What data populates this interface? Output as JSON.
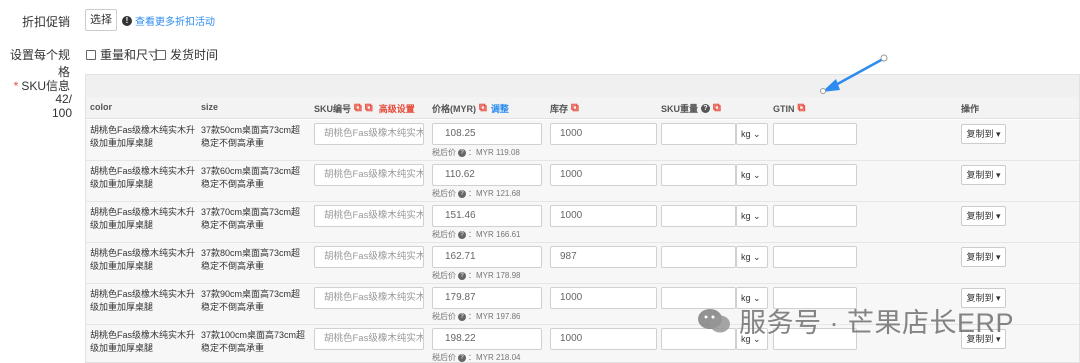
{
  "form": {
    "discount_label": "折扣促销",
    "select_label": "选择",
    "more_discount_link": "查看更多折扣活动",
    "spec_label": "设置每个规格",
    "checkbox_weight_size": "重量和尺寸",
    "checkbox_ship_time": "发货时间",
    "sku_label": "SKU信息",
    "sku_count": "42/ 100"
  },
  "table": {
    "headers": {
      "color": "color",
      "size": "size",
      "sku_code": "SKU编号",
      "advanced": "高级设置",
      "price": "价格(MYR)",
      "adjust": "调整",
      "stock": "库存",
      "weight": "SKU重量",
      "gtin": "GTIN",
      "action": "操作"
    },
    "rows": [
      {
        "color": "胡桃色Fas级橡木纯实木升级加重加厚桌腿",
        "size": "37款50cm桌面高73cm超稳定不倒高承重",
        "sku_code": "胡桃色Fas级橡木纯实木",
        "price": "108.25",
        "post_tax": "MYR 119.08",
        "stock": "1000",
        "unit": "kg",
        "copy": "复制到"
      },
      {
        "color": "胡桃色Fas级橡木纯实木升级加重加厚桌腿",
        "size": "37款60cm桌面高73cm超稳定不倒高承重",
        "sku_code": "胡桃色Fas级橡木纯实木",
        "price": "110.62",
        "post_tax": "MYR 121.68",
        "stock": "1000",
        "unit": "kg",
        "copy": "复制到"
      },
      {
        "color": "胡桃色Fas级橡木纯实木升级加重加厚桌腿",
        "size": "37款70cm桌面高73cm超稳定不倒高承重",
        "sku_code": "胡桃色Fas级橡木纯实木",
        "price": "151.46",
        "post_tax": "MYR 166.61",
        "stock": "1000",
        "unit": "kg",
        "copy": "复制到"
      },
      {
        "color": "胡桃色Fas级橡木纯实木升级加重加厚桌腿",
        "size": "37款80cm桌面高73cm超稳定不倒高承重",
        "sku_code": "胡桃色Fas级橡木纯实木",
        "price": "162.71",
        "post_tax": "MYR 178.98",
        "stock": "987",
        "unit": "kg",
        "copy": "复制到"
      },
      {
        "color": "胡桃色Fas级橡木纯实木升级加重加厚桌腿",
        "size": "37款90cm桌面高73cm超稳定不倒高承重",
        "sku_code": "胡桃色Fas级橡木纯实木",
        "price": "179.87",
        "post_tax": "MYR 197.86",
        "stock": "1000",
        "unit": "kg",
        "copy": "复制到"
      },
      {
        "color": "胡桃色Fas级橡木纯实木升级加重加厚桌腿",
        "size": "37款100cm桌面高73cm超稳定不倒高承重",
        "sku_code": "胡桃色Fas级橡木纯实木",
        "price": "198.22",
        "post_tax": "MYR 218.04",
        "stock": "1000",
        "unit": "kg",
        "copy": "复制到"
      }
    ],
    "post_tax_label": "税后价",
    "post_tax_sep": "："
  },
  "watermark": {
    "text": "服务号 · 芒果店长ERP"
  },
  "colors": {
    "link": "#2d8cf0",
    "accent_red": "#e74c3c",
    "annotation_arrow": "#2d8cf0"
  }
}
